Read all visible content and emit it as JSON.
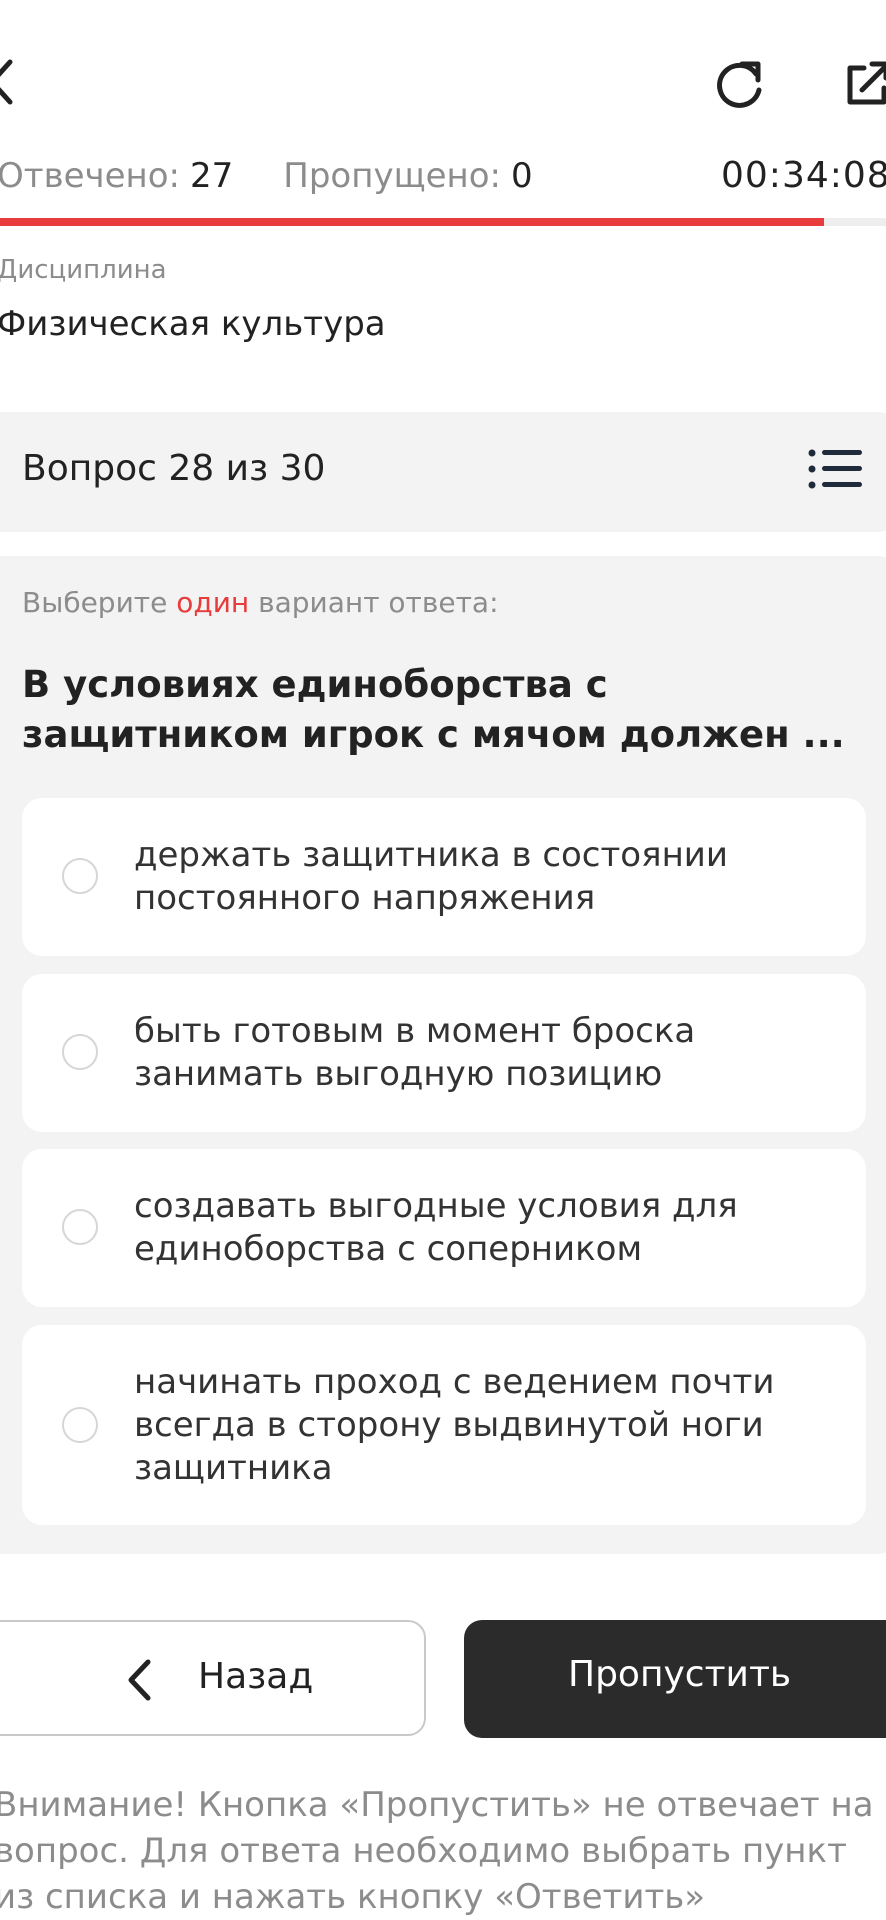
{
  "stats": {
    "answered_label": "Отвечено:",
    "answered_value": "27",
    "skipped_label": "Пропущено:",
    "skipped_value": "0",
    "timer": "00:34:08",
    "progress_fraction": 0.93
  },
  "discipline": {
    "label": "Дисциплина",
    "value": "Физическая культура"
  },
  "question": {
    "counter": "Вопрос 28 из 30",
    "instruction_before": "Выберите ",
    "instruction_accent": "один",
    "instruction_after": " вариант ответа:",
    "text": "В условиях единоборства с защитником игрок с мячом должен ...",
    "options": [
      {
        "label": "держать защитника в состоянии постоянного напряжения"
      },
      {
        "label": "быть готовым в момент броска занимать выгодную позицию"
      },
      {
        "label": "создавать выгодные условия для единоборства с соперником"
      },
      {
        "label": "начинать проход с ведением почти всегда в сторону выдвинутой ноги защитника"
      }
    ]
  },
  "buttons": {
    "back_label": "Назад",
    "skip_label": "Пропустить"
  },
  "warning": "Внимание! Кнопка «Пропустить» не отвечает на вопрос. Для ответа необходимо выбрать пункт из списка и нажать кнопку «Ответить»",
  "icons": {
    "back": "chevron-left-icon",
    "refresh": "refresh-icon",
    "external": "external-link-icon",
    "list": "list-icon"
  },
  "colors": {
    "accent": "#e83b3b",
    "primary_button": "#2b2b2b",
    "card_background": "#f3f3f3"
  }
}
